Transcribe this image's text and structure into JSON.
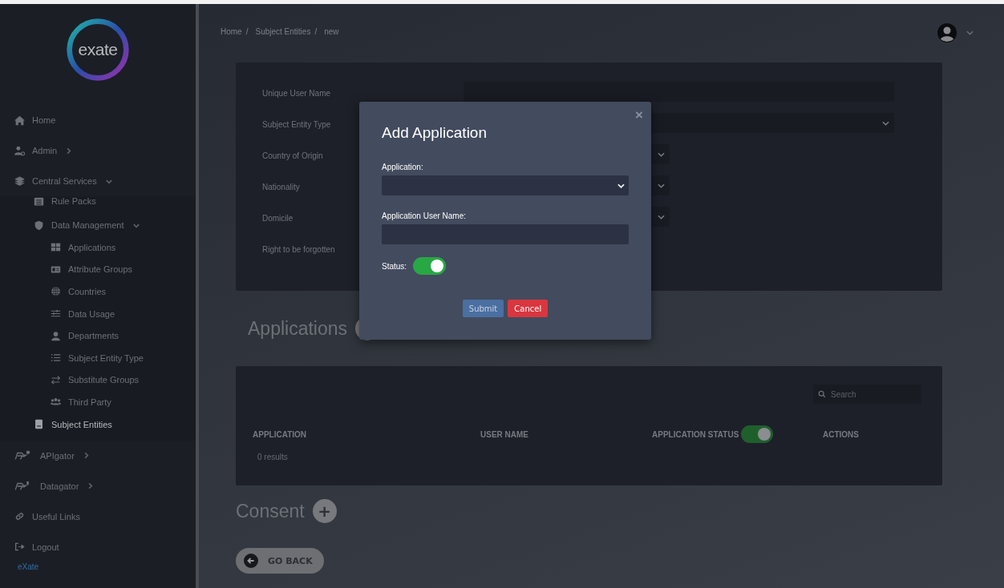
{
  "sidebar": {
    "logo_text": "exate",
    "items": [
      {
        "label": "Home",
        "selected": false
      },
      {
        "label": "Admin",
        "expanded": false,
        "selected": false
      },
      {
        "label": "Central Services",
        "expanded": true,
        "selected": false,
        "children": [
          {
            "label": "Rule Packs",
            "selected": false
          },
          {
            "label": "Data Management",
            "expanded": true,
            "selected": false,
            "children": [
              {
                "label": "Applications",
                "selected": false
              },
              {
                "label": "Attribute Groups",
                "selected": false
              },
              {
                "label": "Countries",
                "selected": false
              },
              {
                "label": "Data Usage",
                "selected": false
              },
              {
                "label": "Departments",
                "selected": false
              },
              {
                "label": "Subject Entity Type",
                "selected": false
              },
              {
                "label": "Substitute Groups",
                "selected": false
              },
              {
                "label": "Third Party",
                "selected": false
              }
            ]
          },
          {
            "label": "Subject Entities",
            "selected": true
          }
        ]
      },
      {
        "label": "APIgator",
        "expanded": false,
        "selected": false
      },
      {
        "label": "Datagator",
        "expanded": false,
        "selected": false
      },
      {
        "label": "Useful Links",
        "selected": false
      },
      {
        "label": "Logout",
        "selected": false
      }
    ],
    "footer": "eXate"
  },
  "breadcrumb": [
    {
      "label": "Home",
      "separator": "/"
    },
    {
      "label": "Subject Entities",
      "separator": "/"
    },
    {
      "label": "new"
    }
  ],
  "form": {
    "fields": [
      {
        "label": "Unique User Name",
        "kind": "text"
      },
      {
        "label": "Subject Entity Type",
        "kind": "select"
      },
      {
        "label": "Country of Origin",
        "kind": "short-select"
      },
      {
        "label": "Nationality",
        "kind": "short-select"
      },
      {
        "label": "Domicile",
        "kind": "short-select"
      },
      {
        "label": "Right to be forgotten",
        "kind": "none"
      }
    ]
  },
  "applications": {
    "title": "Applications",
    "search": {
      "placeholder": "Search"
    },
    "columns": [
      {
        "label": "APPLICATION"
      },
      {
        "label": "USER NAME"
      },
      {
        "label": "APPLICATION STATUS",
        "toggle_on": true
      },
      {
        "label": "ACTIONS"
      }
    ],
    "results": "0 results"
  },
  "consent": {
    "title": "Consent",
    "add_button": "+"
  },
  "go_back": "GO BACK",
  "modal": {
    "title": "Add Application",
    "close": "×",
    "application_label": "Application:",
    "user_name_label": "Application User Name:",
    "status_label": "Status:",
    "status_on": true,
    "buttons": [
      {
        "label": "Submit",
        "kind": "primary"
      },
      {
        "label": "Cancel",
        "kind": "danger"
      }
    ]
  }
}
